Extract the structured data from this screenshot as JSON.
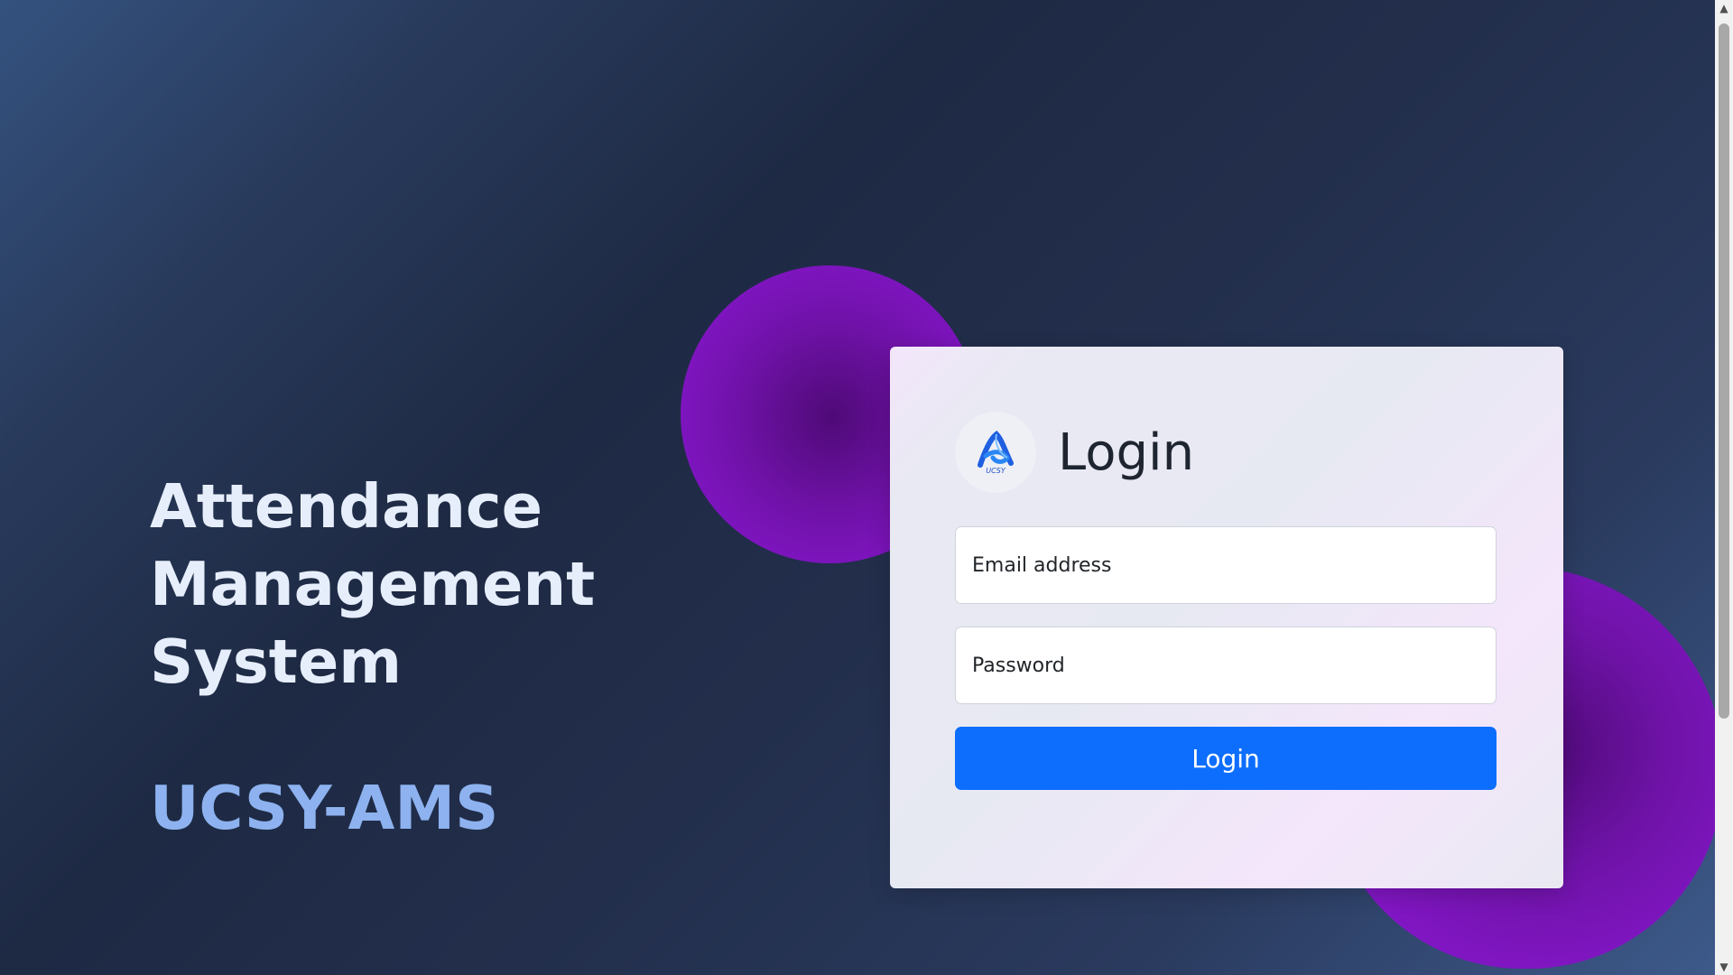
{
  "hero": {
    "title_line1": "Attendance",
    "title_line2": "Management System",
    "brand": "UCSY-AMS"
  },
  "login_card": {
    "logo_text": "UCSY",
    "title": "Login",
    "email_placeholder": "Email address",
    "email_value": "",
    "password_placeholder": "Password",
    "password_value": "",
    "submit_label": "Login"
  },
  "scrollbar": {
    "up_arrow": "▲",
    "down_arrow": "▼"
  },
  "colors": {
    "primary_button": "#0d6efd",
    "brand_text": "#8db2ef",
    "blob_purple": "#8f18d9",
    "background_dark": "#1e2a44"
  },
  "icons": {
    "logo": "ucsy-logo-icon"
  }
}
